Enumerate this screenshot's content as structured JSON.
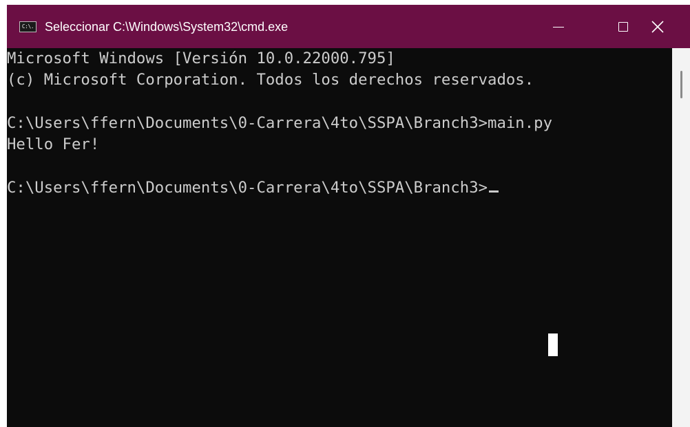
{
  "window": {
    "title": "Seleccionar C:\\Windows\\System32\\cmd.exe",
    "icon_label": "C:\\.",
    "icon_name": "cmd-icon",
    "controls": {
      "minimize_icon": "minimize-icon",
      "maximize_icon": "maximize-icon",
      "close_icon": "close-icon"
    },
    "colors": {
      "titlebar": "#6b0f44",
      "console_bg": "#0c0c0c",
      "console_text": "#cccccc"
    }
  },
  "console": {
    "lines": [
      "Microsoft Windows [Versión 10.0.22000.795]",
      "(c) Microsoft Corporation. Todos los derechos reservados.",
      "",
      "C:\\Users\\ffern\\Documents\\0-Carrera\\4to\\SSPA\\Branch3>main.py",
      "Hello Fer!",
      "",
      "C:\\Users\\ffern\\Documents\\0-Carrera\\4to\\SSPA\\Branch3>"
    ]
  }
}
